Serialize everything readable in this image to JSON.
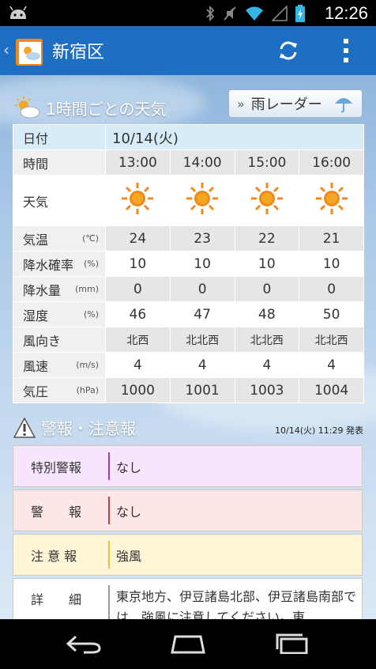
{
  "status": {
    "time": "12:26"
  },
  "app": {
    "title": "新宿区"
  },
  "hourly": {
    "section_title": "1時間ごとの天気",
    "radar_label": "雨レーダー",
    "rows": {
      "date": {
        "label": "日付",
        "value": "10/14(火)"
      },
      "time": {
        "label": "時間",
        "values": [
          "13:00",
          "14:00",
          "15:00",
          "16:00"
        ]
      },
      "weather": {
        "label": "天気",
        "icons": [
          "sun-icon",
          "sun-icon",
          "sun-icon",
          "sun-icon"
        ]
      },
      "temp": {
        "label": "気温",
        "unit": "(℃)",
        "values": [
          "24",
          "23",
          "22",
          "21"
        ]
      },
      "precip_prob": {
        "label": "降水確率",
        "unit": "(%)",
        "values": [
          "10",
          "10",
          "10",
          "10"
        ]
      },
      "precip": {
        "label": "降水量",
        "unit": "(mm)",
        "values": [
          "0",
          "0",
          "0",
          "0"
        ]
      },
      "humidity": {
        "label": "湿度",
        "unit": "(%)",
        "values": [
          "46",
          "47",
          "48",
          "50"
        ]
      },
      "wind_dir": {
        "label": "風向き",
        "values": [
          "北西",
          "北北西",
          "北北西",
          "北北西"
        ]
      },
      "wind_speed": {
        "label": "風速",
        "unit": "(m/s)",
        "values": [
          "4",
          "4",
          "4",
          "4"
        ]
      },
      "pressure": {
        "label": "気圧",
        "unit": "(hPa)",
        "values": [
          "1000",
          "1001",
          "1003",
          "1004"
        ]
      }
    }
  },
  "warnings": {
    "section_title": "警報・注意報",
    "issued": "10/14(火) 11:29 発表",
    "items": [
      {
        "label": "特別警報",
        "value": "なし",
        "bg": "#f7e6fb",
        "accent": "#9b3fc0"
      },
      {
        "label": "警　　報",
        "value": "なし",
        "bg": "#fce6e6",
        "accent": "#d43b3b"
      },
      {
        "label": "注 意 報",
        "value": "強風",
        "bg": "#fdf5d6",
        "accent": "#e8c23a"
      },
      {
        "label": "詳　　細",
        "value": "東京地方、伊豆諸島北部、伊豆諸島南部では、強風に注意してください。東",
        "bg": "#ffffff",
        "accent": "#999999"
      }
    ]
  }
}
